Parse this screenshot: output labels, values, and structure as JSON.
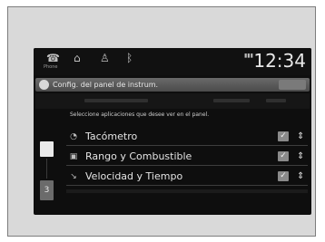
{
  "status_bar": {
    "clock": "12:34",
    "icons": [
      {
        "name": "phone-icon",
        "glyph": "☎",
        "sub": "Phone"
      },
      {
        "name": "nav-icon",
        "glyph": "⌂",
        "sub": ""
      },
      {
        "name": "person-icon",
        "glyph": "♙",
        "sub": ""
      },
      {
        "name": "bluetooth-icon",
        "glyph": "ᛒ",
        "sub": ""
      }
    ]
  },
  "title_bar": {
    "title": "Config. del panel de instrum."
  },
  "instruction": "Seleccione aplicaciones que desee ver en el panel.",
  "list": {
    "items": [
      {
        "label": "Tacómetro",
        "icon": "tachometer-icon",
        "glyph": "◔",
        "checked": true
      },
      {
        "label": "Rango y Combustible",
        "icon": "fuel-icon",
        "glyph": "▣",
        "checked": true
      },
      {
        "label": "Velocidad y Tiempo",
        "icon": "speed-icon",
        "glyph": "↘",
        "checked": true
      }
    ]
  },
  "colors": {
    "screen_bg": "#0e0e0e",
    "title_bar": "#5a5a5a",
    "text": "#e4e4e4",
    "frame_bg": "#d9d9d9"
  }
}
